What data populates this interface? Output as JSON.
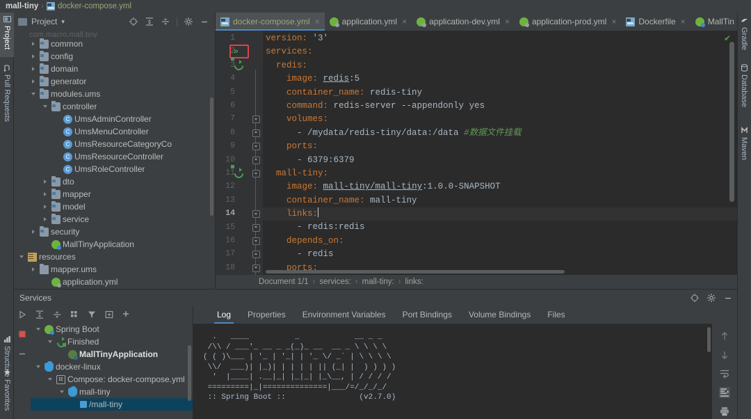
{
  "window": {
    "breadcrumb_project": "mall-tiny",
    "breadcrumb_file": "docker-compose.yml",
    "breadcrumb_sep": "›"
  },
  "left_strip": {
    "tabs": [
      {
        "label": "Project",
        "icon": "project-icon",
        "active": true
      },
      {
        "label": "Pull Requests",
        "icon": "pull-requests-icon",
        "active": false
      }
    ],
    "bottom_tabs": [
      {
        "label": "Structure",
        "icon": "structure-icon"
      },
      {
        "label": "Favorites",
        "icon": "star-icon"
      }
    ]
  },
  "right_strip": {
    "tabs": [
      {
        "label": "Gradle",
        "icon": "gradle-icon"
      },
      {
        "label": "Database",
        "icon": "database-icon"
      },
      {
        "label": "Maven",
        "icon": "maven-icon"
      }
    ]
  },
  "project_panel": {
    "title": "Project",
    "dropdown_caret": "▾",
    "tools": [
      "locate-icon",
      "expand-all-icon",
      "collapse-all-icon",
      "gear-icon",
      "minimize-icon"
    ],
    "ghost_row": "com.macro.mall.tiny",
    "tree": [
      {
        "label": "common",
        "indent": 1,
        "arrow": "right",
        "icon": "folder-package-icon"
      },
      {
        "label": "config",
        "indent": 1,
        "arrow": "right",
        "icon": "folder-package-icon"
      },
      {
        "label": "domain",
        "indent": 1,
        "arrow": "right",
        "icon": "folder-package-icon"
      },
      {
        "label": "generator",
        "indent": 1,
        "arrow": "right",
        "icon": "folder-package-icon"
      },
      {
        "label": "modules.ums",
        "indent": 1,
        "arrow": "down",
        "icon": "folder-package-icon"
      },
      {
        "label": "controller",
        "indent": 2,
        "arrow": "down",
        "icon": "folder-package-icon"
      },
      {
        "label": "UmsAdminController",
        "indent": 3,
        "arrow": "none",
        "icon": "java-class-icon"
      },
      {
        "label": "UmsMenuController",
        "indent": 3,
        "arrow": "none",
        "icon": "java-class-icon"
      },
      {
        "label": "UmsResourceCategoryCo",
        "indent": 3,
        "arrow": "none",
        "icon": "java-class-icon"
      },
      {
        "label": "UmsResourceController",
        "indent": 3,
        "arrow": "none",
        "icon": "java-class-icon"
      },
      {
        "label": "UmsRoleController",
        "indent": 3,
        "arrow": "none",
        "icon": "java-class-icon"
      },
      {
        "label": "dto",
        "indent": 2,
        "arrow": "right",
        "icon": "folder-package-icon"
      },
      {
        "label": "mapper",
        "indent": 2,
        "arrow": "right",
        "icon": "folder-package-icon"
      },
      {
        "label": "model",
        "indent": 2,
        "arrow": "right",
        "icon": "folder-package-icon"
      },
      {
        "label": "service",
        "indent": 2,
        "arrow": "right",
        "icon": "folder-package-icon"
      },
      {
        "label": "security",
        "indent": 1,
        "arrow": "right",
        "icon": "folder-package-icon"
      },
      {
        "label": "MallTinyApplication",
        "indent": 2,
        "arrow": "none",
        "icon": "spring-class-icon"
      },
      {
        "label": "resources",
        "indent": 0,
        "arrow": "down",
        "icon": "resources-icon"
      },
      {
        "label": "mapper.ums",
        "indent": 1,
        "arrow": "right",
        "icon": "folder-plain-icon"
      },
      {
        "label": "application.yml",
        "indent": 2,
        "arrow": "none",
        "icon": "spring-yaml-icon"
      }
    ]
  },
  "editor": {
    "tabs": [
      {
        "label": "docker-compose.yml",
        "icon": "docker-icon",
        "active": true,
        "closable": true
      },
      {
        "label": "application.yml",
        "icon": "spring-yaml-icon",
        "active": false,
        "closable": true
      },
      {
        "label": "application-dev.yml",
        "icon": "spring-yaml-icon",
        "active": false,
        "closable": true
      },
      {
        "label": "application-prod.yml",
        "icon": "spring-yaml-icon",
        "active": false,
        "closable": true
      },
      {
        "label": "Dockerfile",
        "icon": "docker-icon",
        "active": false,
        "closable": true
      },
      {
        "label": "MallTin",
        "icon": "spring-class-icon",
        "active": false,
        "closable": false
      }
    ],
    "tab_overflow_caret": "⌄",
    "inspection_status": "✔",
    "lines": [
      {
        "n": 1,
        "tokens": [
          {
            "t": "version:",
            "c": "k-key"
          },
          {
            "t": " ",
            "c": "k-txt"
          },
          {
            "t": "'3'",
            "c": "k-str"
          }
        ],
        "indent": 0
      },
      {
        "n": 2,
        "tokens": [
          {
            "t": "services:",
            "c": "k-key"
          }
        ],
        "indent": 0,
        "gutter": "run-all",
        "highlight_box": true
      },
      {
        "n": 3,
        "tokens": [
          {
            "t": "redis:",
            "c": "k-key"
          }
        ],
        "indent": 1,
        "gutter": "rerun"
      },
      {
        "n": 4,
        "tokens": [
          {
            "t": "image:",
            "c": "k-key"
          },
          {
            "t": " ",
            "c": "k-txt"
          },
          {
            "t": "redis",
            "c": "k-link"
          },
          {
            "t": ":5",
            "c": "k-txt"
          }
        ],
        "indent": 2
      },
      {
        "n": 5,
        "tokens": [
          {
            "t": "container_name:",
            "c": "k-key"
          },
          {
            "t": " redis-tiny",
            "c": "k-txt"
          }
        ],
        "indent": 2
      },
      {
        "n": 6,
        "tokens": [
          {
            "t": "command:",
            "c": "k-key"
          },
          {
            "t": " redis-server --appendonly yes",
            "c": "k-txt"
          }
        ],
        "indent": 2
      },
      {
        "n": 7,
        "tokens": [
          {
            "t": "volumes:",
            "c": "k-key"
          }
        ],
        "indent": 2,
        "fold": "down"
      },
      {
        "n": 8,
        "tokens": [
          {
            "t": "- /mydata/redis-tiny/data:/data ",
            "c": "k-txt"
          },
          {
            "t": "#数据文件挂载",
            "c": "k-com"
          }
        ],
        "indent": 3,
        "fold": "up"
      },
      {
        "n": 9,
        "tokens": [
          {
            "t": "ports:",
            "c": "k-key"
          }
        ],
        "indent": 2,
        "fold": "down"
      },
      {
        "n": 10,
        "tokens": [
          {
            "t": "- 6379:6379",
            "c": "k-txt"
          }
        ],
        "indent": 3,
        "fold": "up"
      },
      {
        "n": 11,
        "tokens": [
          {
            "t": "mall-tiny:",
            "c": "k-key"
          }
        ],
        "indent": 1,
        "gutter": "rerun",
        "fold": "down"
      },
      {
        "n": 12,
        "tokens": [
          {
            "t": "image:",
            "c": "k-key"
          },
          {
            "t": " ",
            "c": "k-txt"
          },
          {
            "t": "mall-tiny/mall-tiny",
            "c": "k-link"
          },
          {
            "t": ":1.0.0-SNAPSHOT",
            "c": "k-txt"
          }
        ],
        "indent": 2
      },
      {
        "n": 13,
        "tokens": [
          {
            "t": "container_name:",
            "c": "k-key"
          },
          {
            "t": " mall-tiny",
            "c": "k-txt"
          }
        ],
        "indent": 2
      },
      {
        "n": 14,
        "tokens": [
          {
            "t": "links:",
            "c": "k-key"
          }
        ],
        "indent": 2,
        "fold": "down",
        "cursor": true
      },
      {
        "n": 15,
        "tokens": [
          {
            "t": "- redis:redis",
            "c": "k-txt"
          }
        ],
        "indent": 3,
        "fold": "up"
      },
      {
        "n": 16,
        "tokens": [
          {
            "t": "depends_on:",
            "c": "k-key"
          }
        ],
        "indent": 2,
        "fold": "down"
      },
      {
        "n": 17,
        "tokens": [
          {
            "t": "- redis",
            "c": "k-txt"
          }
        ],
        "indent": 3,
        "fold": "up"
      },
      {
        "n": 18,
        "tokens": [
          {
            "t": "ports:",
            "c": "k-key"
          }
        ],
        "indent": 2,
        "fold": "down"
      }
    ],
    "breadcrumbs": [
      "Document 1/1",
      "services:",
      "mall-tiny:",
      "links:"
    ],
    "breadcrumb_sep": "›"
  },
  "services_panel": {
    "title": "Services",
    "header_tools": [
      "locate-icon",
      "gear-icon",
      "minimize-icon"
    ],
    "toolbar": [
      "expand-all-icon",
      "collapse-all-icon",
      "group-icon",
      "filter-icon",
      "add-tab-icon",
      "add-service-icon"
    ],
    "run_buttons": [
      "run-icon",
      "stop-icon",
      "minimize-icon"
    ],
    "tree": [
      {
        "label": "Spring Boot",
        "indent": 0,
        "arrow": "down",
        "icon": "spring-icon",
        "bold": false,
        "selected": false
      },
      {
        "label": "Finished",
        "indent": 1,
        "arrow": "down",
        "icon": "rerun-icon",
        "bold": false,
        "selected": false
      },
      {
        "label": "MallTinyApplication",
        "indent": 2,
        "arrow": "none",
        "icon": "spring-icon-dim",
        "bold": true,
        "selected": false
      },
      {
        "label": "docker-linux",
        "indent": 0,
        "arrow": "down",
        "icon": "docker-whale-icon",
        "bold": false,
        "selected": false
      },
      {
        "label": "Compose: docker-compose.yml",
        "indent": 1,
        "arrow": "down",
        "icon": "compose-icon",
        "bold": false,
        "selected": false
      },
      {
        "label": "mall-tiny",
        "indent": 2,
        "arrow": "down",
        "icon": "docker-whale-icon",
        "bold": false,
        "selected": false
      },
      {
        "label": "/mall-tiny",
        "indent": 3,
        "arrow": "none",
        "icon": "container-icon",
        "bold": false,
        "selected": true
      }
    ],
    "tabs": [
      {
        "label": "Log",
        "active": true
      },
      {
        "label": "Properties",
        "active": false
      },
      {
        "label": "Environment Variables",
        "active": false
      },
      {
        "label": "Port Bindings",
        "active": false
      },
      {
        "label": "Volume Bindings",
        "active": false
      },
      {
        "label": "Files",
        "active": false
      }
    ],
    "log_banner": "  .   ____          _            __ _ _\n /\\\\ / ___'_ __ _ _(_)_ __  __ _ \\ \\ \\ \\\n( ( )\\___ | '_ | '_| | '_ \\/ _` | \\ \\ \\ \\\n \\\\/  ___)| |_)| | | | | || (_| |  ) ) ) )\n  '  |____| .__|_| |_|_| |_\\__, | / / / /\n =========|_|==============|___/=/_/_/_/\n :: Spring Boot ::                (v2.7.0)",
    "log_side_buttons": [
      "scroll-up-icon",
      "scroll-down-icon",
      "soft-wrap-icon",
      "scroll-to-end-icon",
      "print-icon"
    ]
  }
}
